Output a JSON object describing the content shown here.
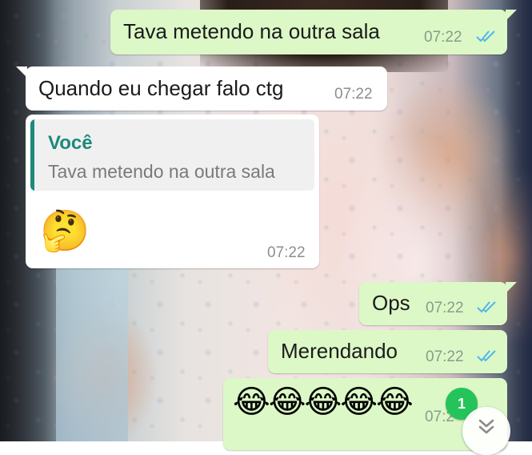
{
  "messages": [
    {
      "id": "m1",
      "direction": "outgoing",
      "text": "Tava metendo na outra sala",
      "time": "07:22",
      "status": "read-ticks-icon"
    },
    {
      "id": "m2",
      "direction": "incoming",
      "text": "Quando eu chegar falo ctg",
      "time": "07:22"
    },
    {
      "id": "m3",
      "direction": "incoming",
      "quote": {
        "author": "Você",
        "text": "Tava metendo na outra sala"
      },
      "emoji": "🤔",
      "time": "07:22"
    },
    {
      "id": "m4",
      "direction": "outgoing",
      "text": "Ops",
      "time": "07:22",
      "status": "read-ticks-icon"
    },
    {
      "id": "m5",
      "direction": "outgoing",
      "text": "Merendando",
      "time": "07:22",
      "status": "read-ticks-icon"
    },
    {
      "id": "m6",
      "direction": "outgoing",
      "emoji": "😂😂😂😂😂",
      "time": "07:2"
    }
  ],
  "unread_badge": {
    "count": "1"
  },
  "scroll_button": {
    "icon": "double-chevron-down-icon"
  },
  "colors": {
    "outgoing_bubble": "#dcf8c6",
    "incoming_bubble": "#ffffff",
    "quote_accent": "#1d8a7a",
    "read_ticks": "#4fb6ec",
    "unread_badge": "#25c45a"
  }
}
